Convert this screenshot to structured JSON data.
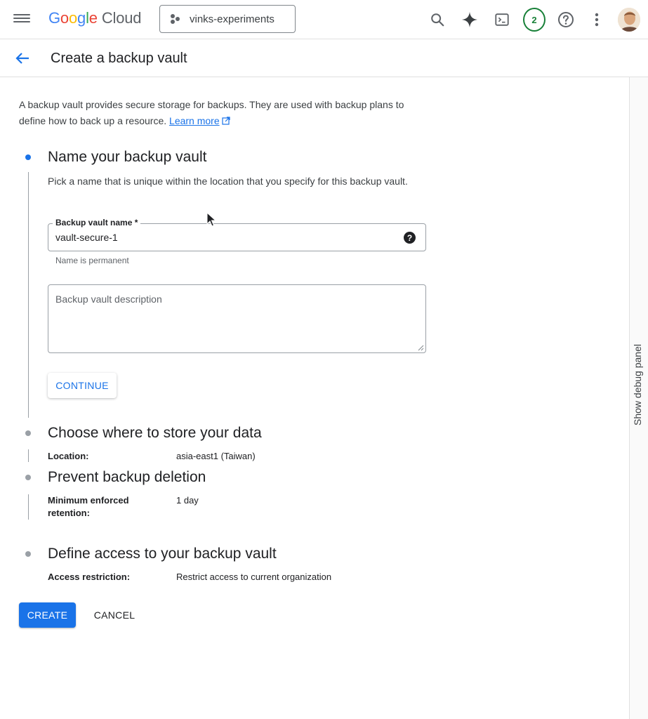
{
  "topbar": {
    "logo_google": [
      "G",
      "o",
      "o",
      "g",
      "l",
      "e"
    ],
    "logo_cloud": "Cloud",
    "project_name": "vinks-experiments",
    "notification_count": "2"
  },
  "subheader": {
    "title": "Create a backup vault"
  },
  "intro": {
    "text": "A backup vault provides secure storage for backups. They are used with backup plans to define how to back up a resource. ",
    "link": "Learn more"
  },
  "steps": [
    {
      "title": "Name your backup vault",
      "description": "Pick a name that is unique within the location that you specify for this backup vault.",
      "name_field": {
        "label": "Backup vault name *",
        "value": "vault-secure-1",
        "hint": "Name is permanent"
      },
      "description_field": {
        "placeholder": "Backup vault description"
      },
      "continue_label": "CONTINUE"
    },
    {
      "title": "Choose where to store your data",
      "label": "Location:",
      "value": "asia-east1 (Taiwan)"
    },
    {
      "title": "Prevent backup deletion",
      "label": "Minimum enforced retention:",
      "value": "1 day"
    },
    {
      "title": "Define access to your backup vault",
      "label": "Access restriction:",
      "value": "Restrict access to current organization"
    }
  ],
  "actions": {
    "create_label": "CREATE",
    "cancel_label": "CANCEL"
  },
  "side_panel": {
    "label": "Show debug panel"
  },
  "colors": {
    "accent": "#1a73e8",
    "badge": "#188038"
  }
}
